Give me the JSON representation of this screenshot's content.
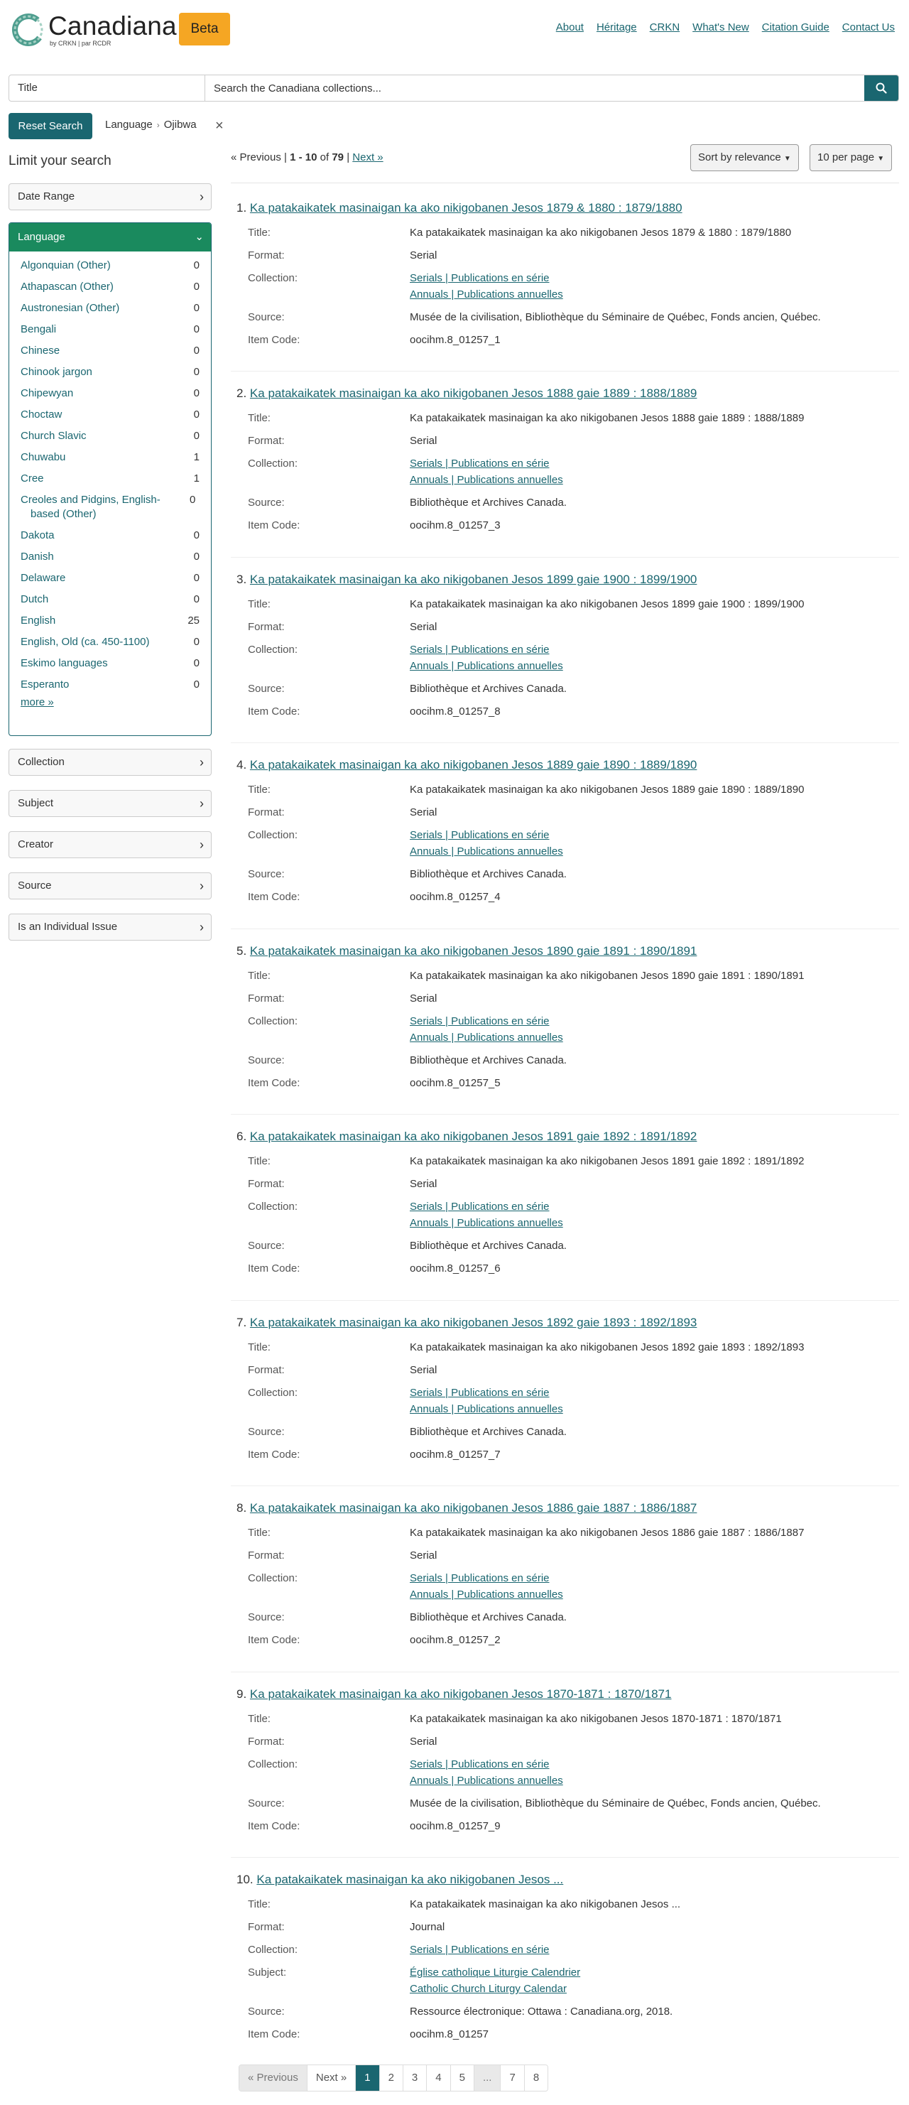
{
  "brand": {
    "name": "Canadiana",
    "sub": "by CRKN | par RCDR",
    "beta": "Beta",
    "accent": "#1a6670",
    "beta_color": "#f5a623"
  },
  "nav": [
    "About",
    "Héritage",
    "CRKN",
    "What's New",
    "Citation Guide",
    "Contact Us"
  ],
  "search": {
    "field": "Title",
    "placeholder": "Search the Canadiana collections...",
    "button_icon": "search-icon"
  },
  "filters": {
    "reset": "Reset Search",
    "chip_field": "Language",
    "chip_value": "Ojibwa",
    "remove_icon": "close-icon"
  },
  "sidebar": {
    "heading": "Limit your search",
    "date_range": "Date Range",
    "language": {
      "label": "Language",
      "items": [
        {
          "name": "Algonquian (Other)",
          "count": "0"
        },
        {
          "name": "Athapascan (Other)",
          "count": "0"
        },
        {
          "name": "Austronesian (Other)",
          "count": "0"
        },
        {
          "name": "Bengali",
          "count": "0"
        },
        {
          "name": "Chinese",
          "count": "0"
        },
        {
          "name": "Chinook jargon",
          "count": "0"
        },
        {
          "name": "Chipewyan",
          "count": "0"
        },
        {
          "name": "Choctaw",
          "count": "0"
        },
        {
          "name": "Church Slavic",
          "count": "0"
        },
        {
          "name": "Chuwabu",
          "count": "1"
        },
        {
          "name": "Cree",
          "count": "1"
        },
        {
          "name": "Creoles and Pidgins, English-based (Other)",
          "count": "0"
        },
        {
          "name": "Dakota",
          "count": "0"
        },
        {
          "name": "Danish",
          "count": "0"
        },
        {
          "name": "Delaware",
          "count": "0"
        },
        {
          "name": "Dutch",
          "count": "0"
        },
        {
          "name": "English",
          "count": "25"
        },
        {
          "name": "English, Old (ca. 450-1100)",
          "count": "0"
        },
        {
          "name": "Eskimo languages",
          "count": "0"
        },
        {
          "name": "Esperanto",
          "count": "0"
        }
      ],
      "more": "more »"
    },
    "facets": [
      "Collection",
      "Subject",
      "Creator",
      "Source",
      "Is an Individual Issue"
    ]
  },
  "results_header": {
    "prev": "« Previous",
    "sep": "|",
    "range": "1 - 10",
    "of": "of",
    "total": "79",
    "next": "Next »",
    "sort": "Sort by relevance",
    "per_page": "10 per page"
  },
  "labels": {
    "title": "Title:",
    "format": "Format:",
    "collection": "Collection:",
    "subject": "Subject:",
    "source": "Source:",
    "item_code": "Item Code:"
  },
  "results": [
    {
      "num": "1.",
      "heading": "Ka patakaikatek masinaigan ka ako nikigobanen Jesos 1879 & 1880 : 1879/1880",
      "title": "Ka patakaikatek masinaigan ka ako nikigobanen Jesos 1879 & 1880 : 1879/1880",
      "format": "Serial",
      "collections": [
        "Serials | Publications en série",
        "Annuals | Publications annuelles"
      ],
      "subjects": [],
      "source": "Musée de la civilisation, Bibliothèque du Séminaire de Québec, Fonds ancien, Québec.",
      "code": "oocihm.8_01257_1"
    },
    {
      "num": "2.",
      "heading": "Ka patakaikatek masinaigan ka ako nikigobanen Jesos 1888 gaie 1889 : 1888/1889",
      "title": "Ka patakaikatek masinaigan ka ako nikigobanen Jesos 1888 gaie 1889 : 1888/1889",
      "format": "Serial",
      "collections": [
        "Serials | Publications en série",
        "Annuals | Publications annuelles"
      ],
      "subjects": [],
      "source": "Bibliothèque et Archives Canada.",
      "code": "oocihm.8_01257_3"
    },
    {
      "num": "3.",
      "heading": "Ka patakaikatek masinaigan ka ako nikigobanen Jesos 1899 gaie 1900 : 1899/1900",
      "title": "Ka patakaikatek masinaigan ka ako nikigobanen Jesos 1899 gaie 1900 : 1899/1900",
      "format": "Serial",
      "collections": [
        "Serials | Publications en série",
        "Annuals | Publications annuelles"
      ],
      "subjects": [],
      "source": "Bibliothèque et Archives Canada.",
      "code": "oocihm.8_01257_8"
    },
    {
      "num": "4.",
      "heading": "Ka patakaikatek masinaigan ka ako nikigobanen Jesos 1889 gaie 1890 : 1889/1890",
      "title": "Ka patakaikatek masinaigan ka ako nikigobanen Jesos 1889 gaie 1890 : 1889/1890",
      "format": "Serial",
      "collections": [
        "Serials | Publications en série",
        "Annuals | Publications annuelles"
      ],
      "subjects": [],
      "source": "Bibliothèque et Archives Canada.",
      "code": "oocihm.8_01257_4"
    },
    {
      "num": "5.",
      "heading": "Ka patakaikatek masinaigan ka ako nikigobanen Jesos 1890 gaie 1891 : 1890/1891",
      "title": "Ka patakaikatek masinaigan ka ako nikigobanen Jesos 1890 gaie 1891 : 1890/1891",
      "format": "Serial",
      "collections": [
        "Serials | Publications en série",
        "Annuals | Publications annuelles"
      ],
      "subjects": [],
      "source": "Bibliothèque et Archives Canada.",
      "code": "oocihm.8_01257_5"
    },
    {
      "num": "6.",
      "heading": "Ka patakaikatek masinaigan ka ako nikigobanen Jesos 1891 gaie 1892 : 1891/1892",
      "title": "Ka patakaikatek masinaigan ka ako nikigobanen Jesos 1891 gaie 1892 : 1891/1892",
      "format": "Serial",
      "collections": [
        "Serials | Publications en série",
        "Annuals | Publications annuelles"
      ],
      "subjects": [],
      "source": "Bibliothèque et Archives Canada.",
      "code": "oocihm.8_01257_6"
    },
    {
      "num": "7.",
      "heading": "Ka patakaikatek masinaigan ka ako nikigobanen Jesos 1892 gaie 1893 : 1892/1893",
      "title": "Ka patakaikatek masinaigan ka ako nikigobanen Jesos 1892 gaie 1893 : 1892/1893",
      "format": "Serial",
      "collections": [
        "Serials | Publications en série",
        "Annuals | Publications annuelles"
      ],
      "subjects": [],
      "source": "Bibliothèque et Archives Canada.",
      "code": "oocihm.8_01257_7"
    },
    {
      "num": "8.",
      "heading": "Ka patakaikatek masinaigan ka ako nikigobanen Jesos 1886 gaie 1887 : 1886/1887",
      "title": "Ka patakaikatek masinaigan ka ako nikigobanen Jesos 1886 gaie 1887 : 1886/1887",
      "format": "Serial",
      "collections": [
        "Serials | Publications en série",
        "Annuals | Publications annuelles"
      ],
      "subjects": [],
      "source": "Bibliothèque et Archives Canada.",
      "code": "oocihm.8_01257_2"
    },
    {
      "num": "9.",
      "heading": "Ka patakaikatek masinaigan ka ako nikigobanen Jesos 1870-1871 : 1870/1871",
      "title": "Ka patakaikatek masinaigan ka ako nikigobanen Jesos 1870-1871 : 1870/1871",
      "format": "Serial",
      "collections": [
        "Serials | Publications en série",
        "Annuals | Publications annuelles"
      ],
      "subjects": [],
      "source": "Musée de la civilisation, Bibliothèque du Séminaire de Québec, Fonds ancien, Québec.",
      "code": "oocihm.8_01257_9"
    },
    {
      "num": "10.",
      "heading": "Ka patakaikatek masinaigan ka ako nikigobanen Jesos ...",
      "title": "Ka patakaikatek masinaigan ka ako nikigobanen Jesos ...",
      "format": "Journal",
      "collections": [
        "Serials | Publications en série"
      ],
      "subjects": [
        "Église catholique Liturgie Calendrier",
        "Catholic Church Liturgy Calendar"
      ],
      "source": "Ressource électronique: Ottawa : Canadiana.org, 2018.",
      "code": "oocihm.8_01257"
    }
  ],
  "pagination": [
    "« Previous",
    "Next »",
    "1",
    "2",
    "3",
    "4",
    "5",
    "...",
    "7",
    "8"
  ]
}
